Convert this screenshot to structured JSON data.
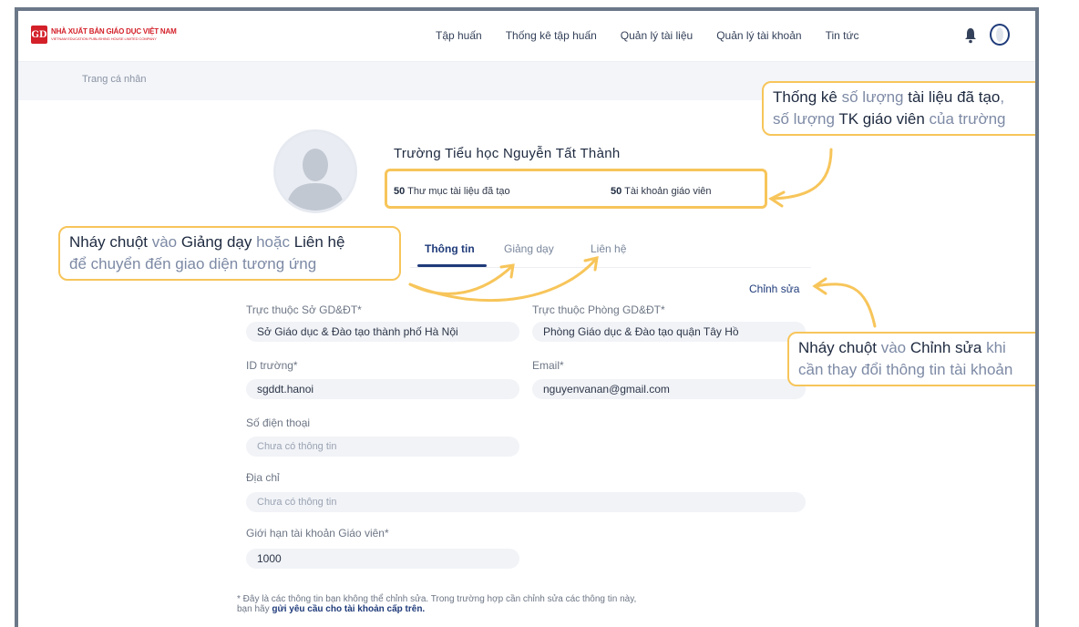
{
  "header": {
    "logo_title": "NHÀ XUẤT BẢN GIÁO DỤC VIỆT NAM",
    "logo_subtitle": "VIETNAM EDUCATION PUBLISHING HOUSE LIMITED COMPANY",
    "logo_mark": "GD",
    "nav": [
      "Tập huấn",
      "Thống kê tập huấn",
      "Quản lý tài liệu",
      "Quản lý tài khoản",
      "Tin tức"
    ]
  },
  "breadcrumb": "Trang cá nhân",
  "profile": {
    "school_name": "Trường Tiểu học Nguyễn Tất Thành",
    "folders_count": "50",
    "folders_label": "Thư mục tài liệu đã tạo",
    "teachers_count": "50",
    "teachers_label": "Tài khoản giáo viên"
  },
  "tabs": [
    "Thông tin",
    "Giảng dạy",
    "Liên hệ"
  ],
  "edit_label": "Chỉnh sửa",
  "form": {
    "department_label": "Trực thuộc Sở GD&ĐT*",
    "department_value": "Sở Giáo dục & Đào tạo thành phố Hà Nội",
    "office_label": "Trực thuộc Phòng GD&ĐT*",
    "office_value": "Phòng Giáo dục & Đào tạo quận Tây Hồ",
    "id_label": "ID trường*",
    "id_value": "sgddt.hanoi",
    "email_label": "Email*",
    "email_value": "nguyenvanan@gmail.com",
    "phone_label": "Số điện thoại",
    "phone_placeholder": "Chưa có thông tin",
    "address_label": "Địa chỉ",
    "address_placeholder": "Chưa có thông tin",
    "limit_label": "Giới hạn tài khoản Giáo viên*",
    "limit_value": "1000"
  },
  "note": {
    "line1": "* Đây là các thông tin bạn không thể chỉnh sửa. Trong trường hợp cần chỉnh sửa các thông tin này,",
    "line2_prefix": "bạn hãy ",
    "line2_link": "gửi yêu cầu cho tài khoản cấp trên."
  },
  "callouts": {
    "stats": {
      "l1_a": "Thống kê ",
      "l1_b": "số lượng",
      "l1_c": " tài liệu đã tạo",
      "l1_d": ",",
      "l2_a": "số lượng",
      "l2_b": " TK giáo viên",
      "l2_c": " của trường"
    },
    "tabs": {
      "l1_a": "Nháy chuột",
      "l1_b": " vào",
      "l1_c": " Giảng dạy",
      "l1_d": " hoặc",
      "l1_e": " Liên hệ",
      "l2": "để chuyển đến giao diện tương ứng"
    },
    "edit": {
      "l1_a": "Nháy chuột",
      "l1_b": " vào",
      "l1_c": " Chỉnh sửa",
      "l1_d": " khi",
      "l2": "cần thay đổi thông tin tài khoản"
    }
  },
  "colors": {
    "accent": "#1f3b7a",
    "callout_border": "#f7c55a",
    "brand_red": "#d32029"
  }
}
